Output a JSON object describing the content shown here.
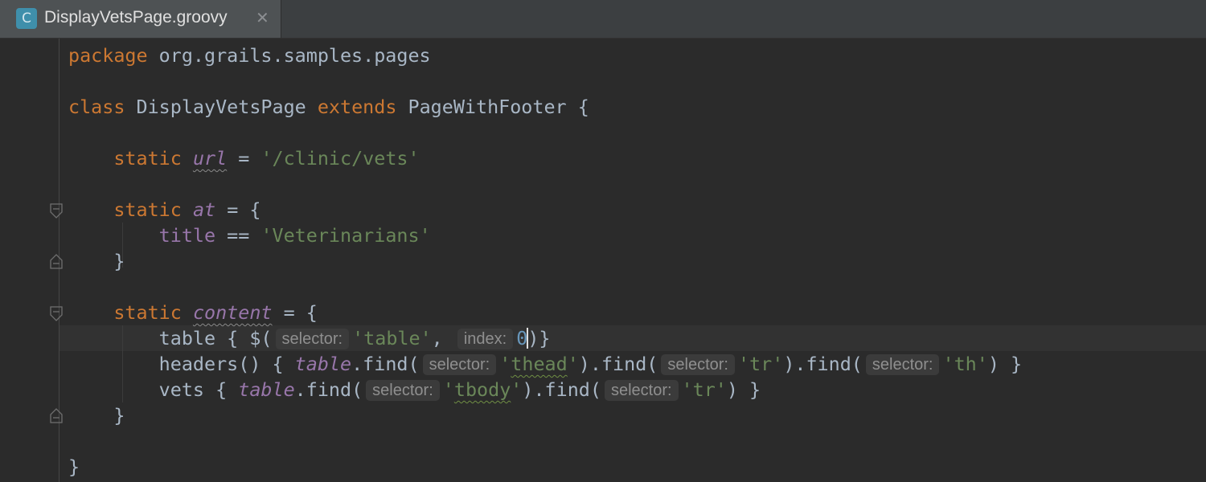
{
  "tab": {
    "icon_letter": "C",
    "title": "DisplayVetsPage.groovy",
    "close_glyph": "✕"
  },
  "code": {
    "l1_kw": "package",
    "l1_rest": " org.grails.samples.pages",
    "l3_kw1": "class",
    "l3_name": " DisplayVetsPage ",
    "l3_kw2": "extends",
    "l3_rest": " PageWithFooter {",
    "l5_kw": "static",
    "l5_field": "url",
    "l5_eq": " = ",
    "l5_str": "'/clinic/vets'",
    "l7_kw": "static",
    "l7_field": "at",
    "l7_rest": " = {",
    "l8_prop": "title",
    "l8_op": " == ",
    "l8_str": "'Veterinarians'",
    "close_brace": "}",
    "l11_kw": "static",
    "l11_field": "content",
    "l11_rest": " = {",
    "l12_a": "table { $(",
    "l12_hint1": "selector:",
    "l12_str": "'table'",
    "l12_comma": ",",
    "l12_hint2": "index:",
    "l12_num": "0",
    "l12_end": ")}",
    "l13_a": "headers() { ",
    "l13_field": "table",
    "l13_b": ".find(",
    "l13_hint1": "selector:",
    "l13_q1": "'",
    "l13_s1": "thead",
    "l13_q2": "'",
    "l13_c": ").find(",
    "l13_hint2": "selector:",
    "l13_s2": "'tr'",
    "l13_d": ").find(",
    "l13_hint3": "selector:",
    "l13_s3": "'th'",
    "l13_e": ") }",
    "l14_a": "vets { ",
    "l14_field": "table",
    "l14_b": ".find(",
    "l14_hint1": "selector:",
    "l14_q1": "'",
    "l14_s1": "tbody",
    "l14_q2": "'",
    "l14_c": ").find(",
    "l14_hint2": "selector:",
    "l14_s2": "'tr'",
    "l14_e": ") }"
  },
  "colors": {
    "background": "#2b2b2b",
    "keyword": "#cc7832",
    "string": "#6a8759",
    "field": "#9876aa",
    "number": "#6897bb",
    "text": "#a9b7c6"
  }
}
